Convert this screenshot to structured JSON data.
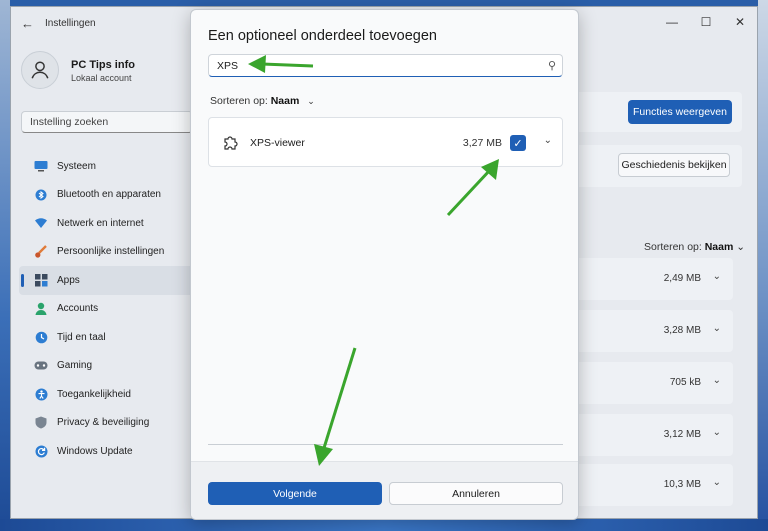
{
  "colors": {
    "accent": "#1f5fb5",
    "arrow": "#3aa52d"
  },
  "window": {
    "title": "Instellingen",
    "back_icon": "back-arrow-icon",
    "controls": [
      "minimize",
      "maximize",
      "close"
    ]
  },
  "profile": {
    "name": "PC Tips info",
    "account_type": "Lokaal account"
  },
  "search": {
    "placeholder": "Instelling zoeken"
  },
  "sidebar": {
    "items": [
      {
        "label": "Systeem",
        "icon": "monitor-icon"
      },
      {
        "label": "Bluetooth en apparaten",
        "icon": "bluetooth-icon"
      },
      {
        "label": "Netwerk en internet",
        "icon": "wifi-icon"
      },
      {
        "label": "Persoonlijke instellingen",
        "icon": "brush-icon"
      },
      {
        "label": "Apps",
        "icon": "apps-icon",
        "active": true
      },
      {
        "label": "Accounts",
        "icon": "person-icon"
      },
      {
        "label": "Tijd en taal",
        "icon": "globe-icon"
      },
      {
        "label": "Gaming",
        "icon": "gamepad-icon"
      },
      {
        "label": "Toegankelijkheid",
        "icon": "accessibility-icon"
      },
      {
        "label": "Privacy & beveiliging",
        "icon": "shield-icon"
      },
      {
        "label": "Windows Update",
        "icon": "update-icon"
      }
    ]
  },
  "right_panel": {
    "view_features_label": "Functies weergeven",
    "view_history_label": "Geschiedenis bekijken",
    "sort_prefix": "Sorteren op:",
    "sort_value": "Naam",
    "sizes": [
      "2,49 MB",
      "3,28 MB",
      "705 kB",
      "3,12 MB",
      "10,3 MB"
    ]
  },
  "dialog": {
    "title": "Een optioneel onderdeel toevoegen",
    "search_value": "XPS",
    "sort_prefix": "Sorteren op:",
    "sort_value": "Naam",
    "feature": {
      "name": "XPS-viewer",
      "size": "3,27 MB",
      "checked": true
    },
    "next_label": "Volgende",
    "cancel_label": "Annuleren"
  }
}
